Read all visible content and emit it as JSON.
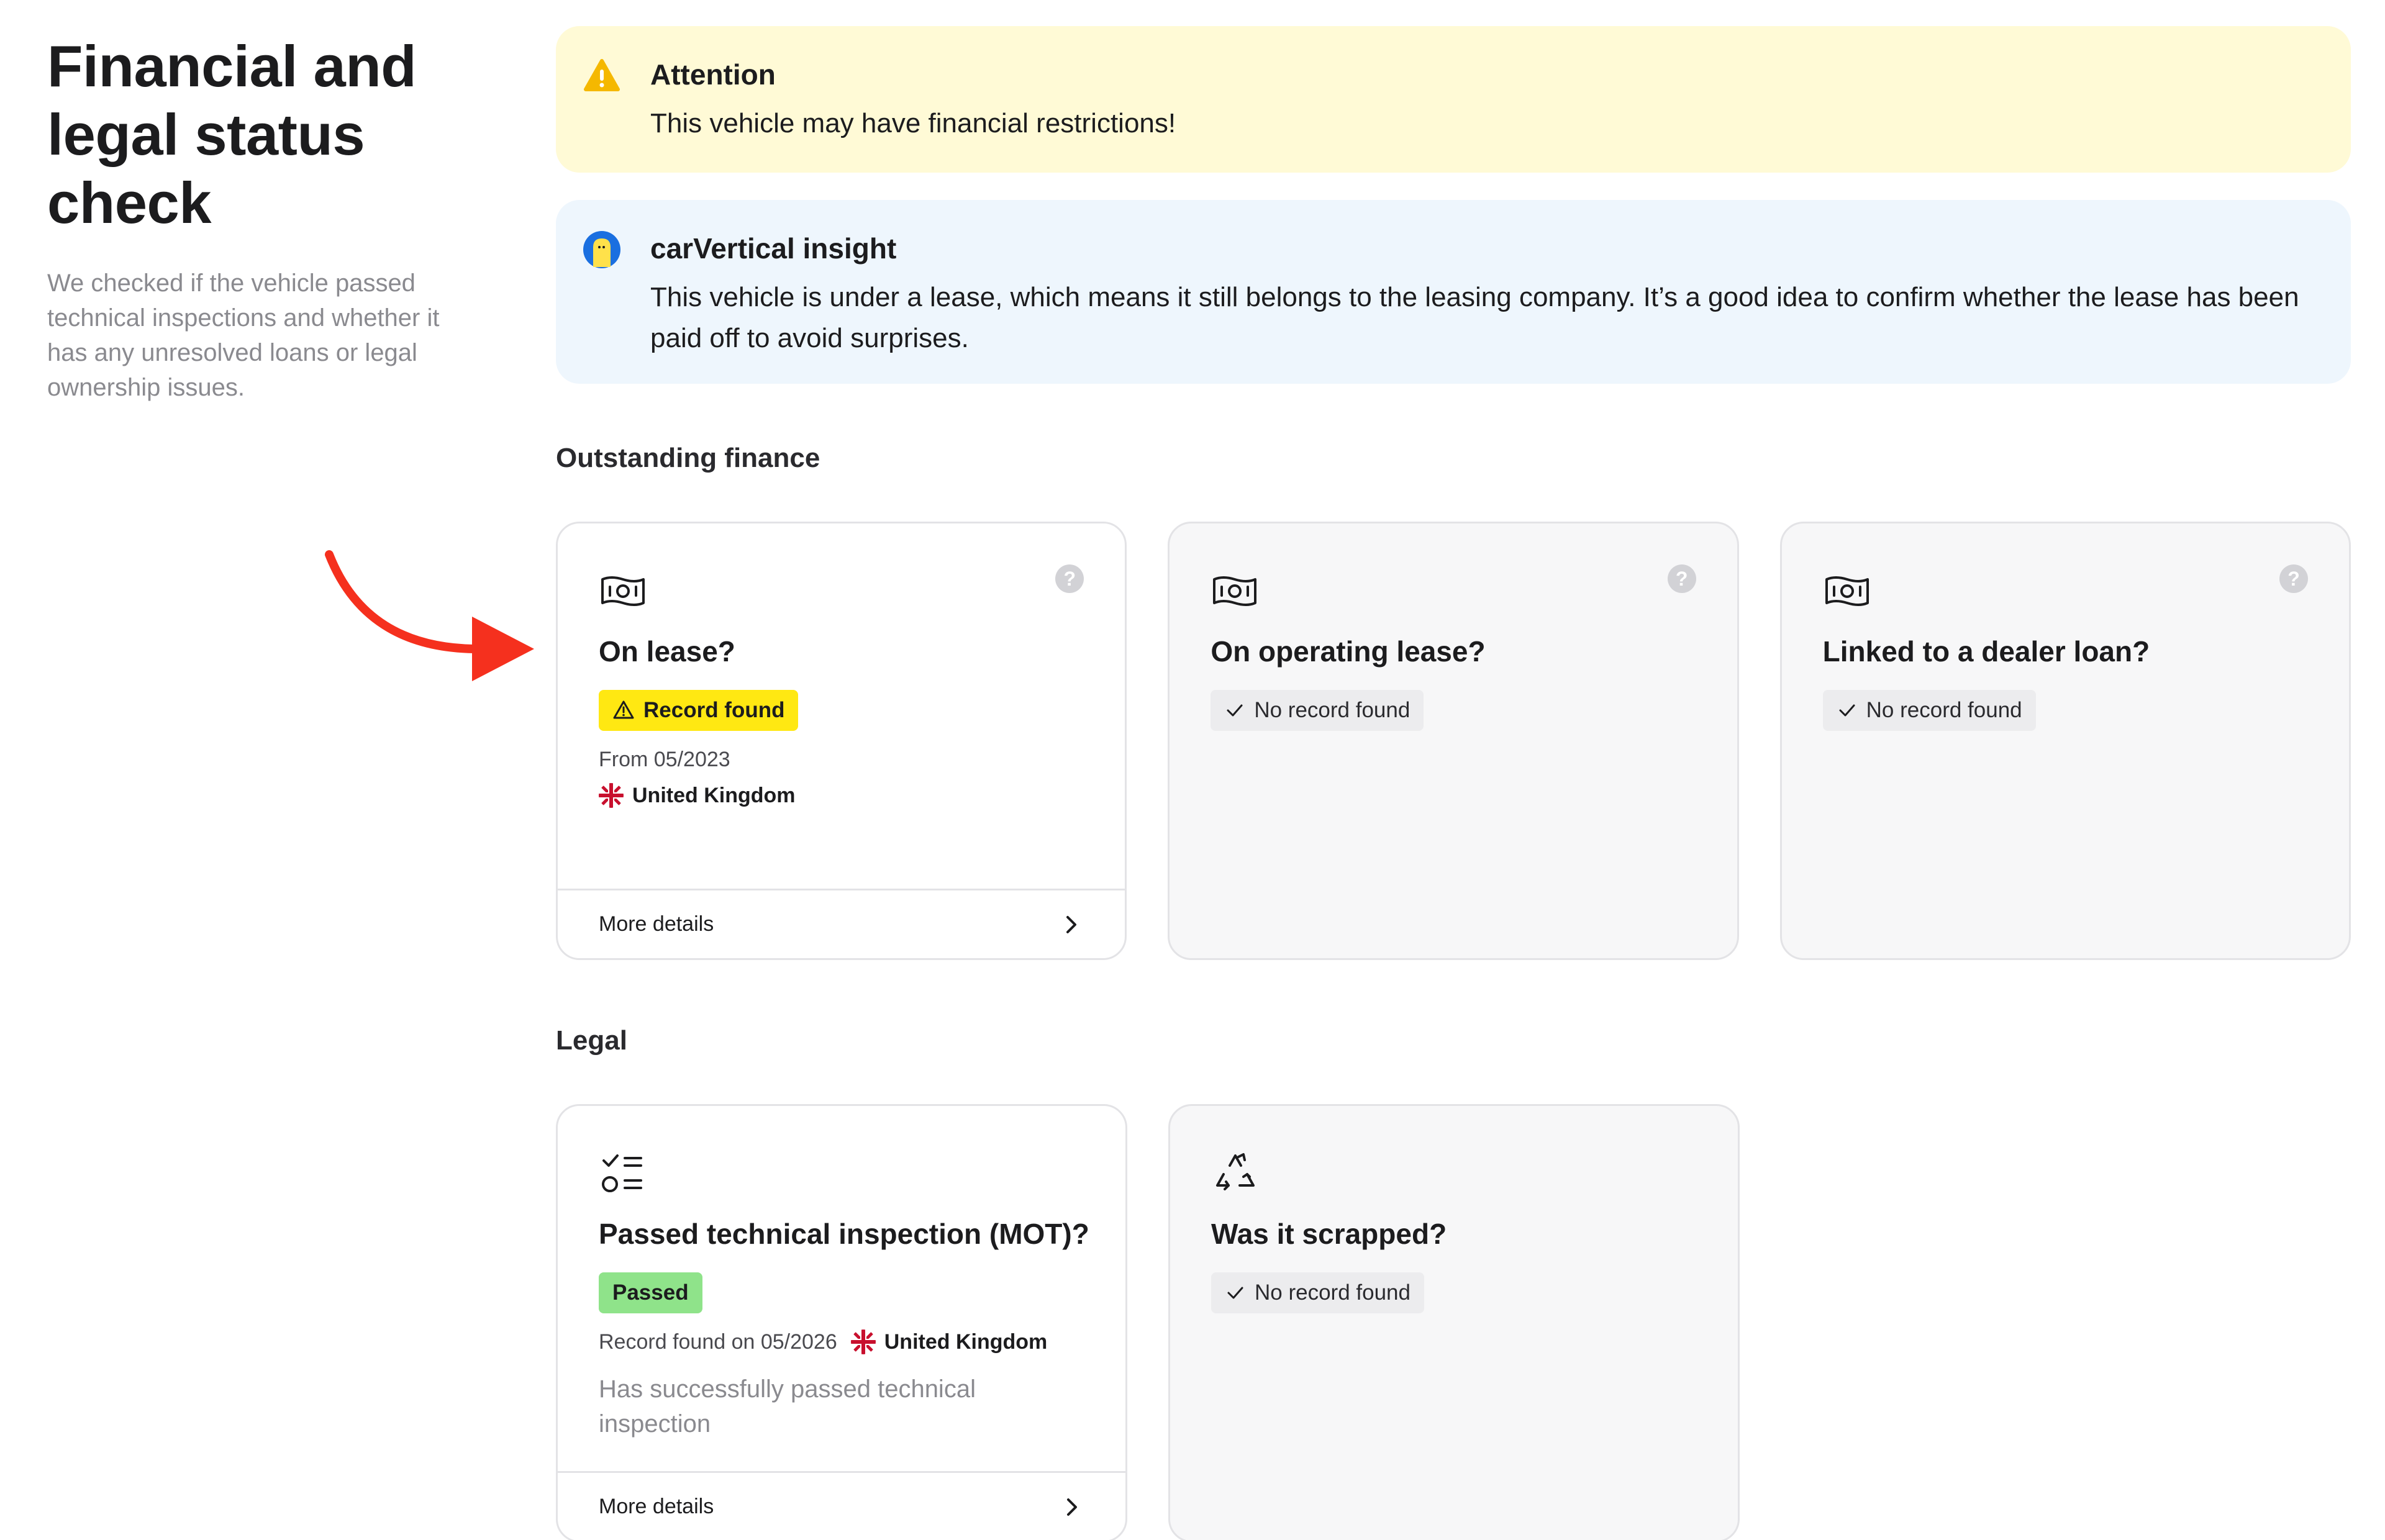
{
  "page": {
    "title": "Financial and legal status check",
    "description": "We checked if the vehicle passed technical inspections and whether it has any unresolved loans or legal ownership issues."
  },
  "alerts": {
    "warning": {
      "title": "Attention",
      "text": "This vehicle may have financial restrictions!",
      "icon": "warning-triangle-icon",
      "color": "#fffad6"
    },
    "insight": {
      "title": "carVertical insight",
      "text": "This vehicle is under a lease, which means it still belongs to the leasing company. It’s a good idea to confirm whether the lease has been paid off to avoid surprises.",
      "icon": "carvertical-mascot-icon",
      "color": "#eef6fd"
    }
  },
  "finance": {
    "section_title": "Outstanding finance",
    "cards": [
      {
        "title": "On lease?",
        "badge": "Record found",
        "date": "From 05/2023",
        "country": "United Kingdom",
        "footer": "More details",
        "icon": "banknote-icon"
      },
      {
        "title": "On operating lease?",
        "badge": "No record found",
        "icon": "banknote-icon"
      },
      {
        "title": "Linked to a dealer loan?",
        "badge": "No record found",
        "icon": "banknote-icon"
      }
    ]
  },
  "legal": {
    "section_title": "Legal",
    "cards": [
      {
        "title": "Passed technical inspection (MOT)?",
        "badge": "Passed",
        "record": "Record found on 05/2026",
        "country": "United Kingdom",
        "note": "Has successfully passed technical inspection",
        "footer": "More details",
        "icon": "checklist-icon"
      },
      {
        "title": "Was it scrapped?",
        "badge": "No record found",
        "icon": "recycle-icon"
      }
    ]
  },
  "help_glyph": "?",
  "colors": {
    "record_found": "#ffe812",
    "passed": "#8fe38a",
    "arrow": "#f5301e"
  }
}
